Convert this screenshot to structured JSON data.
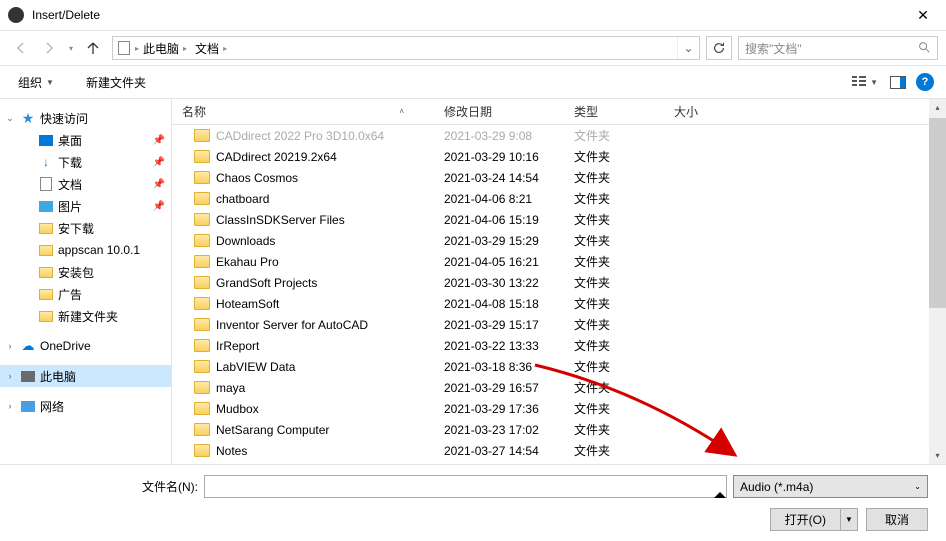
{
  "titlebar": {
    "title": "Insert/Delete"
  },
  "nav": {
    "crumb1": "此电脑",
    "crumb2": "文档",
    "search_placeholder": "搜索\"文档\""
  },
  "toolbar": {
    "organize": "组织",
    "newfolder": "新建文件夹"
  },
  "columns": {
    "name": "名称",
    "date": "修改日期",
    "type": "类型",
    "size": "大小"
  },
  "sidebar": {
    "quick": "快速访问",
    "desktop": "桌面",
    "downloads": "下载",
    "documents": "文档",
    "pictures": "图片",
    "anxia": "安下载",
    "appscan": "appscan 10.0.1",
    "anzhuang": "安装包",
    "guanggao": "广告",
    "newfolder": "新建文件夹",
    "onedrive": "OneDrive",
    "thispc": "此电脑",
    "network": "网络"
  },
  "files": [
    {
      "name": "CADdirect 2022 Pro 3D10.0x64",
      "date": "2021-03-29 9:08",
      "type": "文件夹",
      "dim": true
    },
    {
      "name": "CADdirect 20219.2x64",
      "date": "2021-03-29 10:16",
      "type": "文件夹"
    },
    {
      "name": "Chaos Cosmos",
      "date": "2021-03-24 14:54",
      "type": "文件夹"
    },
    {
      "name": "chatboard",
      "date": "2021-04-06 8:21",
      "type": "文件夹"
    },
    {
      "name": "ClassInSDKServer Files",
      "date": "2021-04-06 15:19",
      "type": "文件夹"
    },
    {
      "name": "Downloads",
      "date": "2021-03-29 15:29",
      "type": "文件夹"
    },
    {
      "name": "Ekahau Pro",
      "date": "2021-04-05 16:21",
      "type": "文件夹"
    },
    {
      "name": "GrandSoft Projects",
      "date": "2021-03-30 13:22",
      "type": "文件夹"
    },
    {
      "name": "HoteamSoft",
      "date": "2021-04-08 15:18",
      "type": "文件夹"
    },
    {
      "name": "Inventor Server for AutoCAD",
      "date": "2021-03-29 15:17",
      "type": "文件夹"
    },
    {
      "name": "IrReport",
      "date": "2021-03-22 13:33",
      "type": "文件夹"
    },
    {
      "name": "LabVIEW Data",
      "date": "2021-03-18 8:36",
      "type": "文件夹"
    },
    {
      "name": "maya",
      "date": "2021-03-29 16:57",
      "type": "文件夹"
    },
    {
      "name": "Mudbox",
      "date": "2021-03-29 17:36",
      "type": "文件夹"
    },
    {
      "name": "NetSarang Computer",
      "date": "2021-03-23 17:02",
      "type": "文件夹"
    },
    {
      "name": "Notes",
      "date": "2021-03-27 14:54",
      "type": "文件夹"
    }
  ],
  "footer": {
    "filename_label": "文件名(N):",
    "filter": "Audio (*.m4a)",
    "open": "打开(O)",
    "cancel": "取消"
  }
}
